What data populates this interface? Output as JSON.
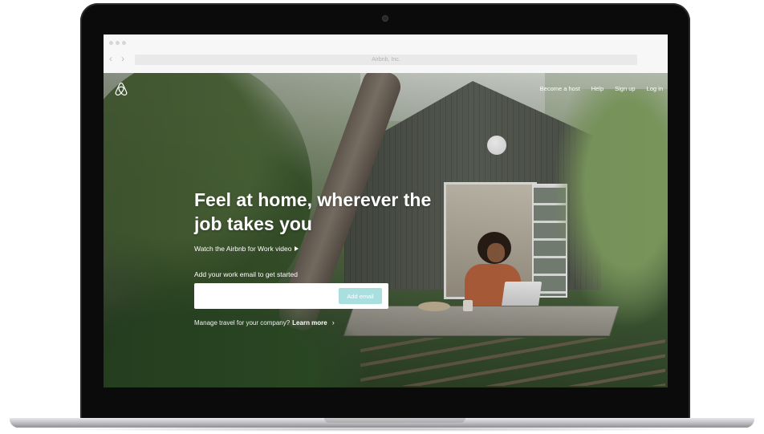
{
  "browser": {
    "url": "Airbnb, Inc.",
    "back_icon": "chevron-left-icon",
    "forward_icon": "chevron-right-icon"
  },
  "header": {
    "logo_icon": "airbnb-logo-icon",
    "nav": {
      "become_host": "Become a host",
      "help": "Help",
      "sign_up": "Sign up",
      "log_in": "Log in"
    }
  },
  "hero": {
    "headline": "Feel at home, wherever the job takes you",
    "video_link": "Watch the Airbnb for Work video",
    "email_label": "Add your work email to get started",
    "email_placeholder": "",
    "add_email_button": "Add email",
    "manage_text": "Manage travel for your company?",
    "learn_more": "Learn more"
  },
  "colors": {
    "button_bg": "#aadfe0",
    "text_on_hero": "#ffffff"
  }
}
